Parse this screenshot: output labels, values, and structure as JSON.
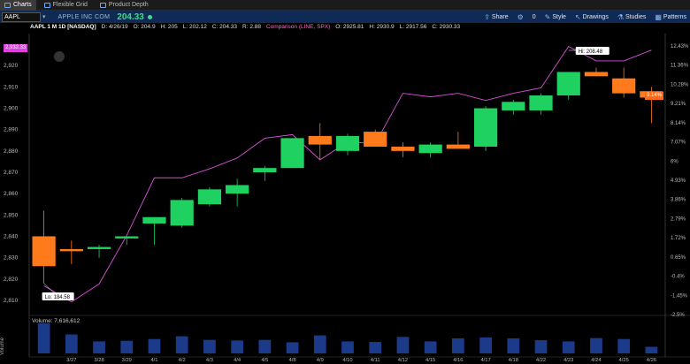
{
  "tabs": [
    {
      "label": "Charts",
      "active": true
    },
    {
      "label": "Flexible Grid",
      "active": false
    },
    {
      "label": "Product Depth",
      "active": false
    }
  ],
  "toolbar": {
    "symbol": "AAPL",
    "company": "APPLE INC COM",
    "price": "204.33",
    "share": "Share",
    "zero": "0",
    "style": "Style",
    "drawings": "Drawings",
    "studies": "Studies",
    "patterns": "Patterns"
  },
  "infobar": {
    "symbol": "AAPL 1 M 1D [NASDAQ]",
    "date": "D: 4/26/19",
    "open": "O: 204.9",
    "high": "H: 205",
    "low": "L: 202.12",
    "close": "C: 204.33",
    "range": "R: 2.88",
    "comparison": "Comparison (LINE, SPX)",
    "cmp_open": "O: 2925.81",
    "cmp_high": "H: 2930.9",
    "cmp_low": "L: 2917.56",
    "cmp_close": "C: 2930.33"
  },
  "price_tags": {
    "left": "2,932.33",
    "right": "9.14%"
  },
  "annotations": {
    "low": "Lo: 184.58",
    "high": "Hi: 208.48"
  },
  "volume": {
    "label": "Volume: 7,616,612",
    "axis_label": "Volume"
  },
  "colors": {
    "up": "#1fd160",
    "down": "#ff7a1a",
    "comparison": "#d94fd9",
    "background": "#000000",
    "volume_bar": "#1b3a8a"
  },
  "chart_data": {
    "type": "candlestick",
    "title": "AAPL 1 M 1D [NASDAQ]",
    "left_axis_label_ticks": [
      "2,920",
      "2,910",
      "2,900",
      "2,890",
      "2,880",
      "2,870",
      "2,860",
      "2,850",
      "2,840",
      "2,830",
      "2,820",
      "2,810"
    ],
    "right_axis_label_ticks": [
      "12.43%",
      "11.36%",
      "10.28%",
      "9.21%",
      "8.14%",
      "7.07%",
      "6%",
      "4.93%",
      "3.86%",
      "2.79%",
      "1.72%",
      "0.65%",
      "-0.4%",
      "-1.45%",
      "-2.5%"
    ],
    "x_labels": [
      "3/27",
      "3/28",
      "3/29",
      "4/1",
      "4/2",
      "4/3",
      "4/4",
      "4/5",
      "4/8",
      "4/9",
      "4/10",
      "4/11",
      "4/12",
      "4/15",
      "4/16",
      "4/17",
      "4/18",
      "4/22",
      "4/23",
      "4/24",
      "4/25",
      "4/26"
    ],
    "ylim_left": [
      2805,
      2935
    ],
    "candles": [
      {
        "o": 2840,
        "h": 2852,
        "l": 2818,
        "c": 2826
      },
      {
        "o": 2834,
        "h": 2838,
        "l": 2827,
        "c": 2833
      },
      {
        "o": 2834,
        "h": 2836,
        "l": 2830,
        "c": 2835
      },
      {
        "o": 2839,
        "h": 2840,
        "l": 2836,
        "c": 2840
      },
      {
        "o": 2846,
        "h": 2849,
        "l": 2836,
        "c": 2849
      },
      {
        "o": 2845,
        "h": 2858,
        "l": 2844,
        "c": 2857
      },
      {
        "o": 2855,
        "h": 2863,
        "l": 2854,
        "c": 2862
      },
      {
        "o": 2860,
        "h": 2867,
        "l": 2854,
        "c": 2864
      },
      {
        "o": 2870,
        "h": 2873,
        "l": 2866,
        "c": 2872
      },
      {
        "o": 2872,
        "h": 2886,
        "l": 2872,
        "c": 2886
      },
      {
        "o": 2887,
        "h": 2893,
        "l": 2876,
        "c": 2883
      },
      {
        "o": 2880,
        "h": 2888,
        "l": 2878,
        "c": 2887
      },
      {
        "o": 2889,
        "h": 2890,
        "l": 2882,
        "c": 2882
      },
      {
        "o": 2882,
        "h": 2884,
        "l": 2877,
        "c": 2880
      },
      {
        "o": 2879,
        "h": 2884,
        "l": 2877,
        "c": 2883
      },
      {
        "o": 2883,
        "h": 2889,
        "l": 2881,
        "c": 2881
      },
      {
        "o": 2882,
        "h": 2901,
        "l": 2880,
        "c": 2900
      },
      {
        "o": 2899,
        "h": 2904,
        "l": 2897,
        "c": 2903
      },
      {
        "o": 2899,
        "h": 2907,
        "l": 2897,
        "c": 2906
      },
      {
        "o": 2906,
        "h": 2917,
        "l": 2904,
        "c": 2917
      },
      {
        "o": 2917,
        "h": 2919,
        "l": 2915,
        "c": 2915
      },
      {
        "o": 2914,
        "h": 2919,
        "l": 2905,
        "c": 2907
      },
      {
        "o": 2908,
        "h": 2910,
        "l": 2893,
        "c": 2905
      }
    ],
    "comparison_pct": [
      -0.9,
      -1.8,
      -0.8,
      1.9,
      5.1,
      5.1,
      5.6,
      6.2,
      7.3,
      7.5,
      6.1,
      7.1,
      7.0,
      9.8,
      9.6,
      9.8,
      9.4,
      9.8,
      10.1,
      12.4,
      11.6,
      11.6,
      12.2
    ],
    "volumes": [
      100,
      63,
      40,
      42,
      48,
      57,
      45,
      43,
      45,
      37,
      60,
      40,
      38,
      55,
      40,
      50,
      53,
      50,
      44,
      40,
      51,
      48,
      22
    ]
  }
}
